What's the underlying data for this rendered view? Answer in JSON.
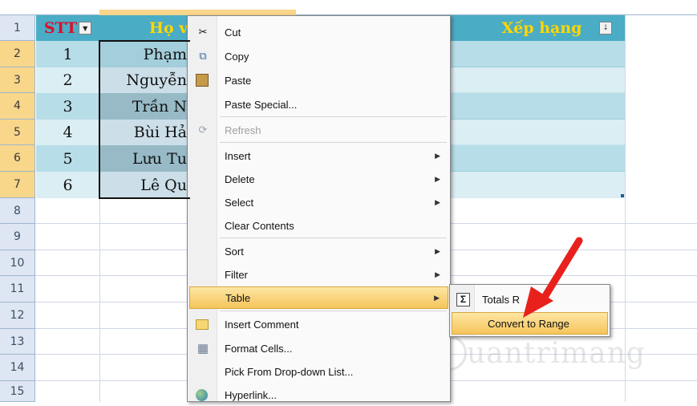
{
  "headers": {
    "stt": "STT",
    "ho_ten": "Họ v",
    "xep_hang": "Xếp hạng"
  },
  "row_numbers": [
    "1",
    "2",
    "3",
    "4",
    "5",
    "6",
    "7",
    "8",
    "9",
    "10",
    "11",
    "12",
    "13",
    "14",
    "15"
  ],
  "rows": [
    {
      "stt": "1",
      "name": "Phạm"
    },
    {
      "stt": "2",
      "name": "Nguyễn"
    },
    {
      "stt": "3",
      "name": "Trần N"
    },
    {
      "stt": "4",
      "name": "Bùi Hả"
    },
    {
      "stt": "5",
      "name": "Lưu Tu"
    },
    {
      "stt": "6",
      "name": "Lê Qu"
    }
  ],
  "context_menu": {
    "items": [
      {
        "label": "Cut",
        "icon": "scissors-icon",
        "glyph": "✂"
      },
      {
        "label": "Copy",
        "icon": "copy-icon",
        "glyph": "⧉"
      },
      {
        "label": "Paste",
        "icon": "paste-icon",
        "glyph": "📋"
      },
      {
        "label": "Paste Special...",
        "icon": "",
        "glyph": ""
      },
      {
        "label": "Refresh",
        "icon": "refresh-icon",
        "glyph": "⟳"
      },
      {
        "label": "Insert",
        "icon": "",
        "glyph": ""
      },
      {
        "label": "Delete",
        "icon": "",
        "glyph": ""
      },
      {
        "label": "Select",
        "icon": "",
        "glyph": ""
      },
      {
        "label": "Clear Contents",
        "icon": "",
        "glyph": ""
      },
      {
        "label": "Sort",
        "icon": "",
        "glyph": ""
      },
      {
        "label": "Filter",
        "icon": "",
        "glyph": ""
      },
      {
        "label": "Table",
        "icon": "",
        "glyph": ""
      },
      {
        "label": "Insert Comment",
        "icon": "comment-icon",
        "glyph": "▭"
      },
      {
        "label": "Format Cells...",
        "icon": "format-cells-icon",
        "glyph": "▦"
      },
      {
        "label": "Pick From Drop-down List...",
        "icon": "",
        "glyph": ""
      },
      {
        "label": "Hyperlink...",
        "icon": "hyperlink-icon",
        "glyph": "🌐"
      }
    ]
  },
  "table_submenu": {
    "items": [
      {
        "label": "Totals R",
        "icon": "sigma-icon",
        "glyph": "Σ"
      },
      {
        "label": "Convert to Range"
      }
    ]
  },
  "watermark": "uantrimang",
  "colors": {
    "header_fill": "#4bacc6",
    "header_text": "#ffd700",
    "stt_header_text": "#d8102c",
    "row_band_a": "#b7dde8",
    "row_band_b": "#dbeef3",
    "highlight": "#f6c55c",
    "arrow": "#e8211d"
  }
}
